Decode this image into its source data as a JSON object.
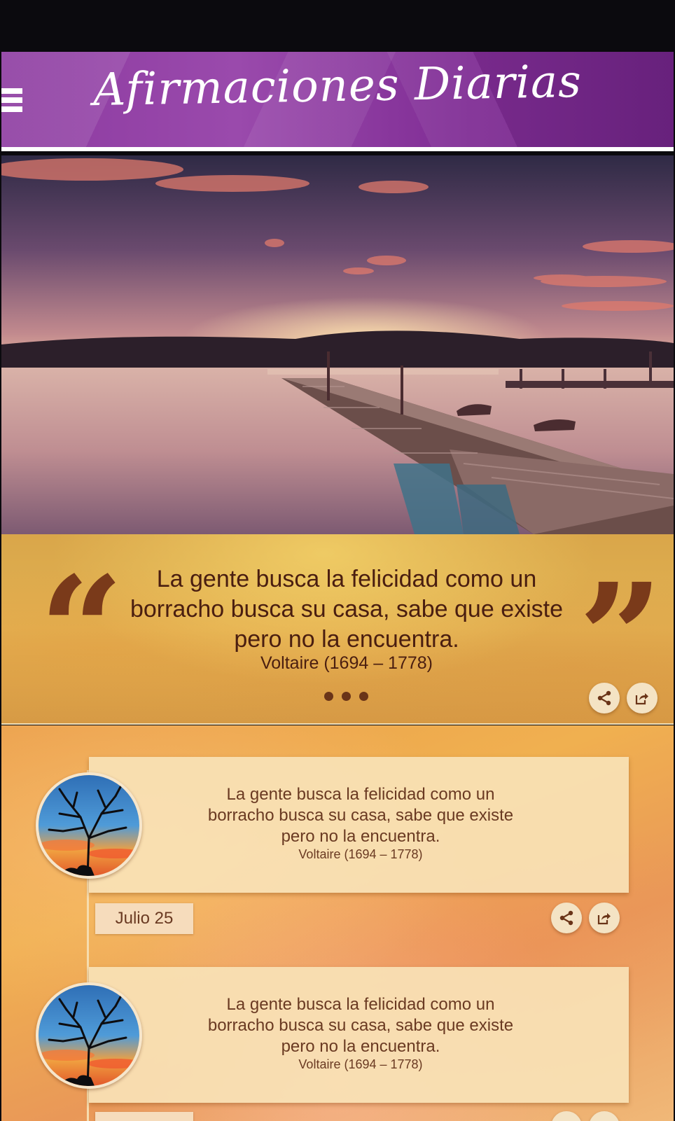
{
  "header": {
    "title": "Afirmaciones Diarias",
    "menu_icon": "hamburger-menu-icon",
    "brand_color": "#8c3aa0"
  },
  "hero": {
    "image": "lake-pier-sunset"
  },
  "featured_quote": {
    "text": "La gente busca la felicidad como un borracho busca su casa, sabe que existe pero no la encuentra.",
    "author": "Voltaire (1694 – 1778)",
    "pager_dots": 3,
    "actions": [
      {
        "name": "share",
        "icon": "share-icon"
      },
      {
        "name": "export",
        "icon": "export-icon"
      }
    ]
  },
  "timeline": {
    "items": [
      {
        "text": "La gente busca la felicidad como un borracho busca su casa, sabe que existe pero no la encuentra.",
        "author": "Voltaire (1694 – 1778)",
        "date": "Julio 25",
        "avatar": "tree-sunset-avatar"
      },
      {
        "text": "La gente busca la felicidad como un borracho busca su casa, sabe que existe pero no la encuentra.",
        "author": "Voltaire (1694 – 1778)",
        "date": "",
        "avatar": "tree-sunset-avatar"
      }
    ]
  }
}
